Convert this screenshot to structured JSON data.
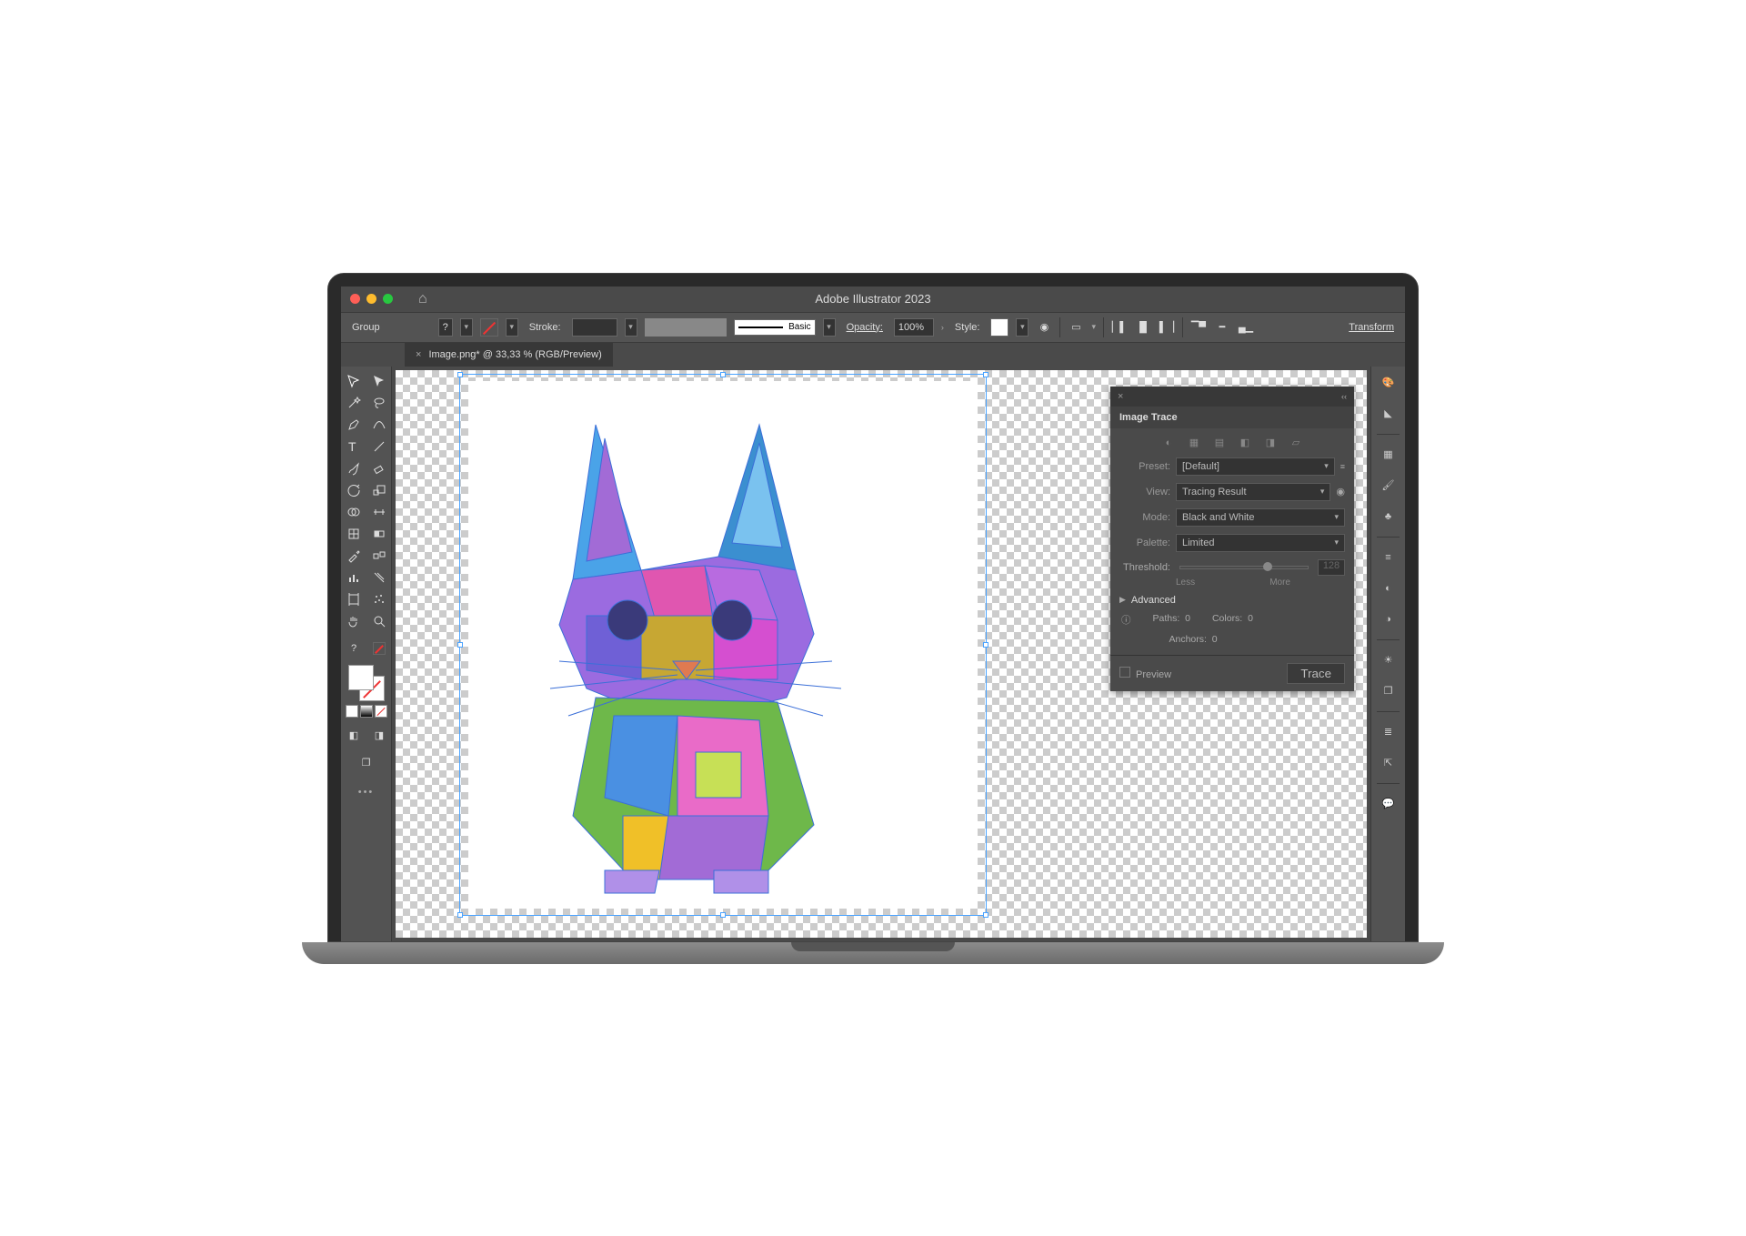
{
  "app": {
    "title": "Adobe Illustrator 2023"
  },
  "controlbar": {
    "group_label": "Group",
    "fill_value": "?",
    "stroke_label": "Stroke:",
    "brush_basic": "Basic",
    "opacity_label": "Opacity:",
    "opacity_value": "100%",
    "style_label": "Style:",
    "transform_label": "Transform"
  },
  "tab": {
    "label": "Image.png* @ 33,33 % (RGB/Preview)"
  },
  "toolbox": {
    "tools_col1": [
      "selection",
      "magic-wand",
      "pen",
      "type",
      "paintbrush",
      "rotate",
      "shape-builder",
      "mesh",
      "eyedropper",
      "column-graph",
      "artboard",
      "hand"
    ],
    "tools_col2": [
      "direct-selection",
      "lasso",
      "curvature",
      "line-segment",
      "eraser",
      "scale",
      "width",
      "gradient",
      "blend",
      "slice",
      "symbol-sprayer",
      "zoom"
    ]
  },
  "panel": {
    "title": "Image Trace",
    "preset_label": "Preset:",
    "preset_value": "[Default]",
    "view_label": "View:",
    "view_value": "Tracing Result",
    "mode_label": "Mode:",
    "mode_value": "Black and White",
    "palette_label": "Palette:",
    "palette_value": "Limited",
    "threshold_label": "Threshold:",
    "threshold_value": "128",
    "threshold_min": "Less",
    "threshold_max": "More",
    "advanced_label": "Advanced",
    "paths_label": "Paths:",
    "paths_value": "0",
    "colors_label": "Colors:",
    "colors_value": "0",
    "anchors_label": "Anchors:",
    "anchors_value": "0",
    "preview_label": "Preview",
    "trace_button": "Trace"
  },
  "dock": {
    "items": [
      "color",
      "color-guide",
      "swatches",
      "brushes",
      "symbols",
      "stroke",
      "gradient",
      "transparency",
      "appearance",
      "layers",
      "asset-export",
      "comments"
    ]
  }
}
